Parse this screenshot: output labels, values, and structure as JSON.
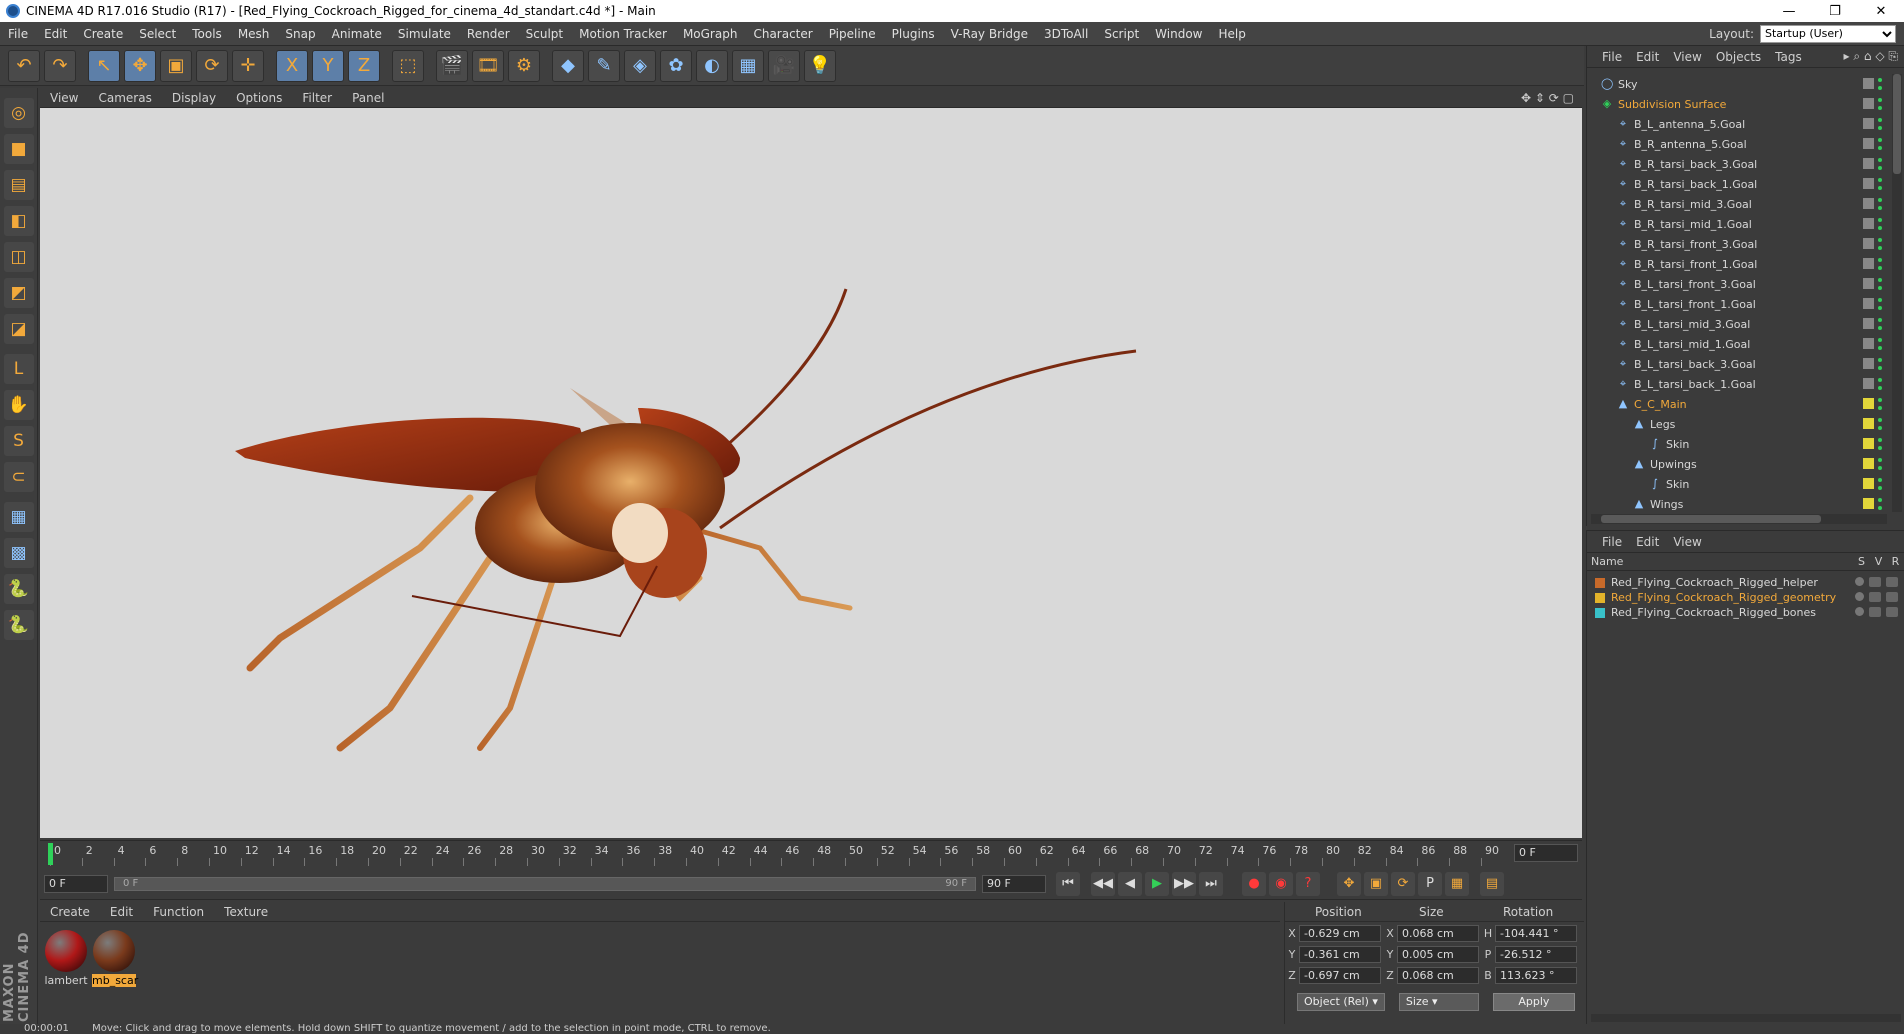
{
  "window": {
    "title": "CINEMA 4D R17.016 Studio (R17) - [Red_Flying_Cockroach_Rigged_for_cinema_4d_standart.c4d *] - Main",
    "minimize": "—",
    "restore": "❐",
    "close": "✕"
  },
  "menu": {
    "items": [
      "File",
      "Edit",
      "Create",
      "Select",
      "Tools",
      "Mesh",
      "Snap",
      "Animate",
      "Simulate",
      "Render",
      "Sculpt",
      "Motion Tracker",
      "MoGraph",
      "Character",
      "Pipeline",
      "Plugins",
      "V-Ray Bridge",
      "3DToAll",
      "Script",
      "Window",
      "Help"
    ],
    "layout_label": "Layout:",
    "layout_value": "Startup (User)"
  },
  "toolbar": {
    "icons": [
      "undo-icon",
      "redo-icon",
      "select-cursor-icon",
      "move-icon",
      "scale-icon",
      "rotate-icon",
      "transform-icon",
      "x-axis-icon",
      "y-axis-icon",
      "z-axis-icon",
      "coordinate-system-icon",
      "render-view-icon",
      "render-picture-viewer-icon",
      "render-settings-icon",
      "cube-icon",
      "pen-spline-icon",
      "subdivision-icon",
      "array-icon",
      "deformer-icon",
      "floor-icon",
      "camera-icon",
      "light-icon"
    ],
    "glyphs": [
      "↶",
      "↷",
      "↖",
      "✥",
      "▣",
      "⟳",
      "✛",
      "X",
      "Y",
      "Z",
      "⬚",
      "🎬",
      "🎞",
      "⚙",
      "◆",
      "✎",
      "◈",
      "✿",
      "◐",
      "▦",
      "🎥",
      "💡"
    ]
  },
  "left_tools": {
    "icons": [
      "make-editable-icon",
      "model-mode-icon",
      "texture-mode-icon",
      "workplane-icon",
      "points-mode-icon",
      "edges-mode-icon",
      "polygons-mode-icon",
      "axis-icon",
      "tweak-icon",
      "snap-icon",
      "magnet-icon",
      "grid-lock-icon",
      "grid-icon",
      "python-icon",
      "python2-icon"
    ],
    "glyphs": [
      "◎",
      "■",
      "▤",
      "◧",
      "◫",
      "◩",
      "◪",
      "L",
      "✋",
      "S",
      "⊂",
      "▦",
      "▩",
      "🐍",
      "🐍"
    ]
  },
  "viewport": {
    "menu": [
      "View",
      "Cameras",
      "Display",
      "Options",
      "Filter",
      "Panel"
    ],
    "controls": "✥ ⇕ ⟳ ▢"
  },
  "timeline": {
    "ticks": [
      "0",
      "2",
      "4",
      "6",
      "8",
      "10",
      "12",
      "14",
      "16",
      "18",
      "20",
      "22",
      "24",
      "26",
      "28",
      "30",
      "32",
      "34",
      "36",
      "38",
      "40",
      "42",
      "44",
      "46",
      "48",
      "50",
      "52",
      "54",
      "56",
      "58",
      "60",
      "62",
      "64",
      "66",
      "68",
      "70",
      "72",
      "74",
      "76",
      "78",
      "80",
      "82",
      "84",
      "86",
      "88",
      "90"
    ],
    "current_frame": "0 F"
  },
  "transport": {
    "start_field": "0 F",
    "range_start": "0 F",
    "range_end": "90 F",
    "end_field": "90 F",
    "buttons": [
      "⏮",
      "◀◀",
      "◀",
      "▶",
      "▶▶",
      "⏭"
    ]
  },
  "materials": {
    "menu": [
      "Create",
      "Edit",
      "Function",
      "Texture"
    ],
    "items": [
      {
        "name": "lambert",
        "color": "#b01818"
      },
      {
        "name": "mb_scar",
        "color": "#7a3a1c"
      }
    ]
  },
  "coords": {
    "headers": [
      "Position",
      "Size",
      "Rotation"
    ],
    "rows": [
      {
        "axis": "X",
        "pos": "-0.629 cm",
        "size_axis": "X",
        "size": "0.068 cm",
        "rot_axis": "H",
        "rot": "-104.441 °"
      },
      {
        "axis": "Y",
        "pos": "-0.361 cm",
        "size_axis": "Y",
        "size": "0.005 cm",
        "rot_axis": "P",
        "rot": "-26.512 °"
      },
      {
        "axis": "Z",
        "pos": "-0.697 cm",
        "size_axis": "Z",
        "size": "0.068 cm",
        "rot_axis": "B",
        "rot": "113.623 °"
      }
    ],
    "mode_dropdown": "Object (Rel)",
    "size_dropdown": "Size",
    "apply_label": "Apply"
  },
  "object_manager": {
    "menu": [
      "File",
      "Edit",
      "View",
      "Objects",
      "Tags"
    ],
    "objects": [
      {
        "name": "Sky",
        "indent": 0,
        "icon": "◯",
        "hl": false,
        "yellow": false
      },
      {
        "name": "Subdivision Surface",
        "indent": 0,
        "icon": "◈",
        "hl": true,
        "yellow": false
      },
      {
        "name": "B_L_antenna_5.Goal",
        "indent": 1,
        "icon": "⌖",
        "hl": false,
        "yellow": false
      },
      {
        "name": "B_R_antenna_5.Goal",
        "indent": 1,
        "icon": "⌖",
        "hl": false,
        "yellow": false
      },
      {
        "name": "B_R_tarsi_back_3.Goal",
        "indent": 1,
        "icon": "⌖",
        "hl": false,
        "yellow": false
      },
      {
        "name": "B_R_tarsi_back_1.Goal",
        "indent": 1,
        "icon": "⌖",
        "hl": false,
        "yellow": false
      },
      {
        "name": "B_R_tarsi_mid_3.Goal",
        "indent": 1,
        "icon": "⌖",
        "hl": false,
        "yellow": false
      },
      {
        "name": "B_R_tarsi_mid_1.Goal",
        "indent": 1,
        "icon": "⌖",
        "hl": false,
        "yellow": false
      },
      {
        "name": "B_R_tarsi_front_3.Goal",
        "indent": 1,
        "icon": "⌖",
        "hl": false,
        "yellow": false
      },
      {
        "name": "B_R_tarsi_front_1.Goal",
        "indent": 1,
        "icon": "⌖",
        "hl": false,
        "yellow": false
      },
      {
        "name": "B_L_tarsi_front_3.Goal",
        "indent": 1,
        "icon": "⌖",
        "hl": false,
        "yellow": false
      },
      {
        "name": "B_L_tarsi_front_1.Goal",
        "indent": 1,
        "icon": "⌖",
        "hl": false,
        "yellow": false
      },
      {
        "name": "B_L_tarsi_mid_3.Goal",
        "indent": 1,
        "icon": "⌖",
        "hl": false,
        "yellow": false
      },
      {
        "name": "B_L_tarsi_mid_1.Goal",
        "indent": 1,
        "icon": "⌖",
        "hl": false,
        "yellow": false
      },
      {
        "name": "B_L_tarsi_back_3.Goal",
        "indent": 1,
        "icon": "⌖",
        "hl": false,
        "yellow": false
      },
      {
        "name": "B_L_tarsi_back_1.Goal",
        "indent": 1,
        "icon": "⌖",
        "hl": false,
        "yellow": false
      },
      {
        "name": "C_C_Main",
        "indent": 1,
        "icon": "▲",
        "hl": true,
        "yellow": true
      },
      {
        "name": "Legs",
        "indent": 2,
        "icon": "▲",
        "hl": false,
        "yellow": true
      },
      {
        "name": "Skin",
        "indent": 3,
        "icon": "∫",
        "hl": false,
        "yellow": true
      },
      {
        "name": "Upwings",
        "indent": 2,
        "icon": "▲",
        "hl": false,
        "yellow": true
      },
      {
        "name": "Skin",
        "indent": 3,
        "icon": "∫",
        "hl": false,
        "yellow": true
      },
      {
        "name": "Wings",
        "indent": 2,
        "icon": "▲",
        "hl": false,
        "yellow": true
      }
    ]
  },
  "layer_manager": {
    "menu": [
      "File",
      "Edit",
      "View"
    ],
    "name_header": "Name",
    "cols": [
      "S",
      "V",
      "R"
    ],
    "layers": [
      {
        "name": "Red_Flying_Cockroach_Rigged_helper",
        "color": "#c86a2a",
        "text_color": "#d8d8d8"
      },
      {
        "name": "Red_Flying_Cockroach_Rigged_geometry",
        "color": "#e2b32a",
        "text_color": "#f2a93b"
      },
      {
        "name": "Red_Flying_Cockroach_Rigged_bones",
        "color": "#39c1c9",
        "text_color": "#d8d8d8"
      }
    ]
  },
  "status": {
    "time": "00:00:01",
    "message": "Move: Click and drag to move elements. Hold down SHIFT to quantize movement / add to the selection in point mode, CTRL to remove."
  },
  "brand": "MAXON CINEMA 4D"
}
